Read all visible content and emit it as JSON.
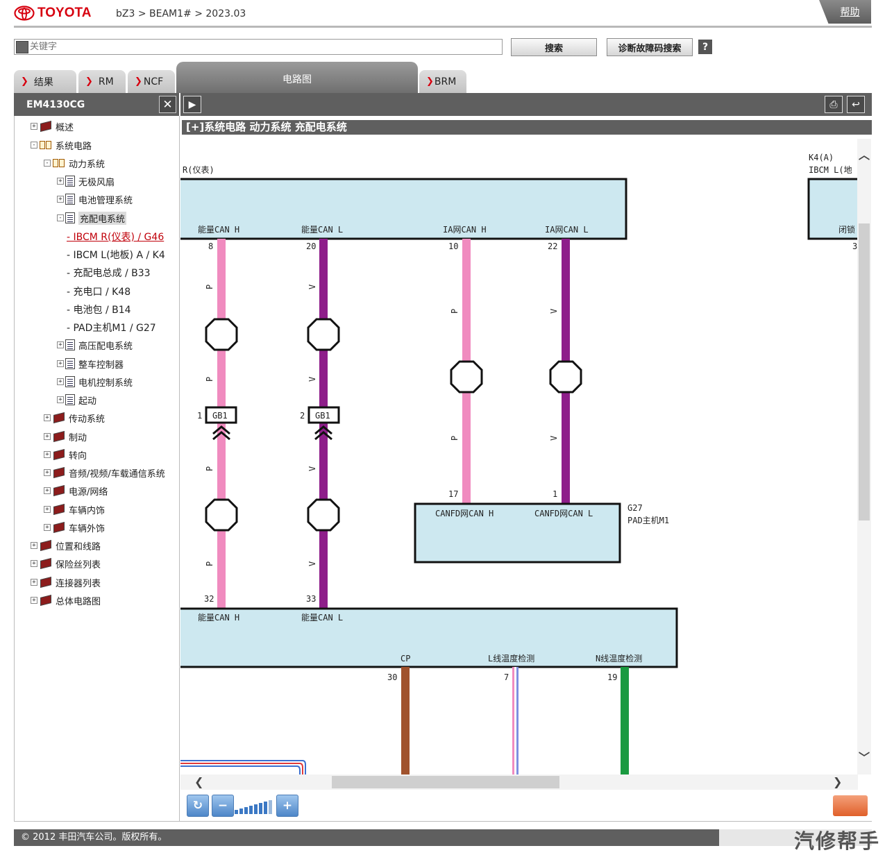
{
  "header": {
    "brand": "TOYOTA",
    "breadcrumb": "bZ3 > BEAM1# > 2023.03",
    "help": "帮助"
  },
  "search": {
    "placeholder": "关键字",
    "search_btn": "搜索",
    "diag_btn": "诊断故障码搜索",
    "help_btn": "?"
  },
  "tabs": [
    {
      "label": "结果"
    },
    {
      "label": "RM"
    },
    {
      "label": "NCF"
    },
    {
      "label": "电路图"
    },
    {
      "label": "BRM"
    }
  ],
  "left": {
    "code": "EM4130CG",
    "close": "✕"
  },
  "tree": [
    {
      "label": "概述",
      "pm": "+",
      "icon": "book"
    },
    {
      "label": "系统电路",
      "pm": "-",
      "icon": "openbook"
    },
    {
      "label": "动力系统",
      "pm": "-",
      "icon": "openbook"
    },
    {
      "label": "无极风扇",
      "pm": "+",
      "icon": "doc"
    },
    {
      "label": "电池管理系统",
      "pm": "+",
      "icon": "doc"
    },
    {
      "label": "充配电系统",
      "pm": "-",
      "icon": "doc"
    },
    {
      "label": "高压配电系统",
      "pm": "+",
      "icon": "doc"
    },
    {
      "label": "整车控制器",
      "pm": "+",
      "icon": "doc"
    },
    {
      "label": "电机控制系统",
      "pm": "+",
      "icon": "doc"
    },
    {
      "label": "起动",
      "pm": "+",
      "icon": "doc"
    },
    {
      "label": "传动系统",
      "pm": "+",
      "icon": "book"
    },
    {
      "label": "制动",
      "pm": "+",
      "icon": "book"
    },
    {
      "label": "转向",
      "pm": "+",
      "icon": "book"
    },
    {
      "label": "音频/视频/车载通信系统",
      "pm": "+",
      "icon": "book"
    },
    {
      "label": "电源/网络",
      "pm": "+",
      "icon": "book"
    },
    {
      "label": "车辆内饰",
      "pm": "+",
      "icon": "book"
    },
    {
      "label": "车辆外饰",
      "pm": "+",
      "icon": "book"
    },
    {
      "label": "位置和线路",
      "pm": "+",
      "icon": "book"
    },
    {
      "label": "保险丝列表",
      "pm": "+",
      "icon": "book"
    },
    {
      "label": "连接器列表",
      "pm": "+",
      "icon": "book"
    },
    {
      "label": "总体电路图",
      "pm": "+",
      "icon": "book"
    }
  ],
  "leaves": [
    "- IBCM R(仪表) / G46",
    "- IBCM L(地板) A / K4",
    "- 充配电总成 / B33",
    "- 充电口 / K48",
    "- 电池包 / B14",
    "- PAD主机M1 / G27"
  ],
  "diagram": {
    "title": "[+]系统电路  动力系统  充配电系统",
    "top_box_name": "R(仪表)",
    "k4_code": "K4(A)",
    "k4_name": "IBCM L(地",
    "k4_pin_label": "闭锁",
    "k4_pin": "3",
    "top_pins": [
      {
        "label": "能量CAN H",
        "num": "8",
        "color": "P"
      },
      {
        "label": "能量CAN L",
        "num": "20",
        "color": "V"
      },
      {
        "label": "IA网CAN H",
        "num": "10",
        "color": "P"
      },
      {
        "label": "IA网CAN L",
        "num": "22",
        "color": "V"
      }
    ],
    "connector": "GB1",
    "conn_pins": [
      "1",
      "2"
    ],
    "g27_code": "G27",
    "g27_name": "PAD主机M1",
    "g27_pins": [
      {
        "label": "CANFD网CAN H",
        "num": "17"
      },
      {
        "label": "CANFD网CAN L",
        "num": "1"
      }
    ],
    "bottom_top_pins": [
      {
        "label": "能量CAN H",
        "num": "32"
      },
      {
        "label": "能量CAN L",
        "num": "33"
      }
    ],
    "bottom_pins": [
      {
        "label": "CP",
        "num": "30"
      },
      {
        "label": "L线温度检测",
        "num": "7"
      },
      {
        "label": "N线温度检测",
        "num": "19"
      }
    ],
    "colors": {
      "pink": "#f08bbf",
      "violet": "#8e1e8a",
      "brown": "#a0522d",
      "green": "#1a9a40",
      "box": "#cde8f0"
    }
  },
  "footer": {
    "copyright": "© 2012 丰田汽车公司。版权所有。",
    "brand": "汽修帮手"
  }
}
